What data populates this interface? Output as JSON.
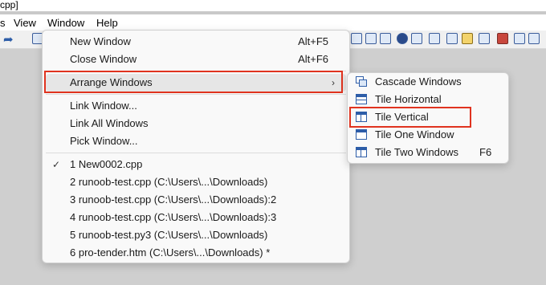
{
  "titlebar": {
    "text": "cpp]"
  },
  "menubar": {
    "items": [
      {
        "label": "s"
      },
      {
        "label": "View"
      },
      {
        "label": "Window"
      },
      {
        "label": "Help"
      }
    ]
  },
  "window_menu": {
    "new_window": {
      "label": "New Window",
      "shortcut": "Alt+F5"
    },
    "close_window": {
      "label": "Close Window",
      "shortcut": "Alt+F6"
    },
    "arrange_windows": {
      "label": "Arrange Windows",
      "arrow": "›"
    },
    "link_window": {
      "label": "Link Window..."
    },
    "link_all_windows": {
      "label": "Link All Windows"
    },
    "pick_window": {
      "label": "Pick Window..."
    },
    "open_windows": [
      {
        "label": "1  New0002.cpp",
        "checked": "✓"
      },
      {
        "label": "2  runoob-test.cpp (C:\\Users\\...\\Downloads)"
      },
      {
        "label": "3  runoob-test.cpp (C:\\Users\\...\\Downloads):2"
      },
      {
        "label": "4  runoob-test.cpp (C:\\Users\\...\\Downloads):3"
      },
      {
        "label": "5  runoob-test.py3 (C:\\Users\\...\\Downloads)"
      },
      {
        "label": "6  pro-tender.htm (C:\\Users\\...\\Downloads) *"
      }
    ]
  },
  "arrange_submenu": {
    "cascade": {
      "label": "Cascade Windows",
      "icon": "cascade-windows-icon"
    },
    "tile_horizontal": {
      "label": "Tile Horizontal",
      "icon": "tile-horizontal-icon"
    },
    "tile_vertical": {
      "label": "Tile Vertical",
      "icon": "tile-vertical-icon"
    },
    "tile_one": {
      "label": "Tile One Window",
      "icon": "tile-one-window-icon"
    },
    "tile_two": {
      "label": "Tile Two Windows",
      "shortcut": "F6",
      "icon": "tile-two-windows-icon"
    }
  },
  "colors": {
    "highlight": "#e0331f",
    "icon_blue": "#2d5da8"
  }
}
